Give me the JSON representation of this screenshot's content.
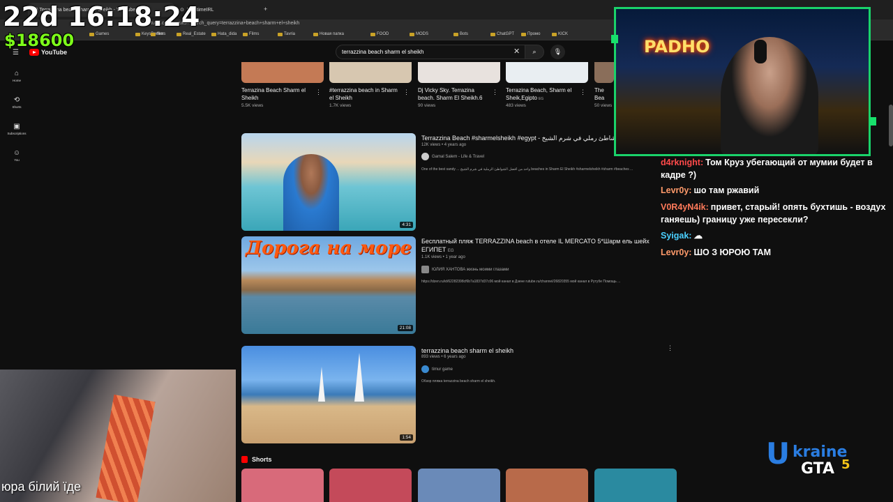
{
  "browser": {
    "tabs": [
      {
        "label": "(7) Terrazzina beach sharm el sheikh - YouTube",
        "active": true
      },
      {
        "label": "RealtimeIRL",
        "active": false
      }
    ],
    "new_tab": "+",
    "url": "youtube.com/results?search_query=terrazzina+beach+sharm+el+sheikh",
    "bookmarks": [
      "Games",
      "KeysBorher",
      "films",
      "Real_Estate",
      "Hata_dida",
      "Films",
      "Tavria",
      "Новая папка",
      "FOOD",
      "MODS",
      "Bots",
      "ChatGPT",
      "Промо",
      "KICK"
    ]
  },
  "youtube": {
    "logo_text": "YouTube",
    "search_value": "terrazzina beach sharm el sheikh",
    "nav": [
      {
        "label": "Home",
        "icon": "home-icon"
      },
      {
        "label": "Shorts",
        "icon": "shorts-icon"
      },
      {
        "label": "Subscriptions",
        "icon": "subscriptions-icon"
      },
      {
        "label": "You",
        "icon": "you-icon"
      }
    ],
    "top_row": [
      {
        "title": "Terrazina Beach Sharm el Sheikh",
        "views": "5.5K views",
        "color": "#c47a55"
      },
      {
        "title": "#terrazzina beach in Sharm el Sheikh",
        "views": "1.7K views",
        "color": "#d7c7b0"
      },
      {
        "title": "Dj Vicky Sky. Terrazina beach. Sharm El Sheikh.6",
        "views": "90 views",
        "color": "#e8e2de"
      },
      {
        "title": "Terrazina Beach, Sharm el Sheik,Egipto",
        "title_badge": "EG",
        "views": "483 views",
        "color": "#e9eef2"
      },
      {
        "title": "The Bea Sharm e",
        "views": "50 views",
        "color": "#8a6e5a"
      }
    ],
    "videos": [
      {
        "title": "Terrazzina Beach #sharmelsheikh #egypt - ندور على شاطئ رملي في شرم الشيخ",
        "meta": "12K views • 4 years ago",
        "channel": "Gamal Salem - Life & Travel",
        "description": "One of the best sandy ... واحد من أفضل الشواطئ الرملية في شرم الشيخ beaches in Sharm El Sheikh #sharmelsheikh #sharm #beaches ...",
        "duration": "4:31"
      },
      {
        "title": "Бесплатный пляж TERRAZZINA beach в отеле IL MERCATO 5*Шарм ель шейх ЕГИПЕТ",
        "title_badge": "EG",
        "meta": "1.1K views • 1 year ago",
        "channel": "ЮЛИЯ ХАНТОВА жизнь моими глазами",
        "description": "https://dzen.ru/id/62282398cf6b7a1837d37c06 мой канал в Дзене rutube.ru/channel/26820355 мой канал в Рутубе Помощь ...",
        "duration": "21:08",
        "thumb_text": "Дорога на море"
      },
      {
        "title": "terrazzina beach sharm el sheikh",
        "meta": "893 views • 6 years ago",
        "channel": "timur game",
        "description": "Обзор пляжа terrazzina beach sharm el sheikh.",
        "duration": "1:54"
      }
    ],
    "shorts_heading": "Shorts",
    "shorts_colors": [
      "#d86a7a",
      "#c44a5a",
      "#6a8ab8",
      "#b86a4a",
      "#2a8aa0"
    ]
  },
  "overlay": {
    "timer": "22d 16:18:24",
    "money": "$18600",
    "cam_sign": "PADHO",
    "chat": [
      {
        "user": "d4rknight:",
        "msg": "Том Круз убегающий от мумии будет в кадре ?)",
        "color": "#ff4a4a"
      },
      {
        "user": "Levr0y:",
        "msg": "шо там ржавий",
        "color": "#ff9a6a"
      },
      {
        "user": "V0R4yN4ik:",
        "msg": "привет, старый! опять бухтишь - воздух ганяешь) границу уже пересекли?",
        "color": "#ff7a5a"
      },
      {
        "user": "Syigak:",
        "msg": "☁",
        "color": "#4ad0ff"
      },
      {
        "user": "Levr0y:",
        "msg": "ШО З ЮРОЮ ТАМ",
        "color": "#ff9a6a"
      }
    ],
    "caption": "юра білий їде",
    "brand": {
      "part1": "U",
      "part2": "kraine",
      "part3": "GTA",
      "part4": "5"
    }
  }
}
